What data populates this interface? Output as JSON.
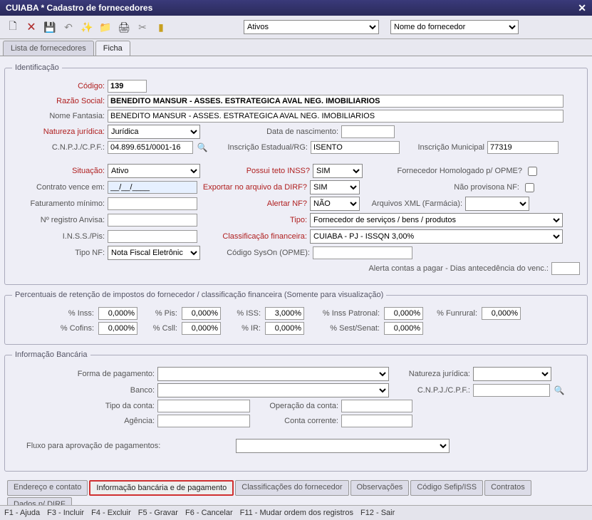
{
  "window": {
    "title": "CUIABA * Cadastro de fornecedores"
  },
  "toolbar": {
    "filter1": "Ativos",
    "filter2": "Nome do fornecedor"
  },
  "tabs": {
    "list": "Lista de fornecedores",
    "ficha": "Ficha"
  },
  "identificacao": {
    "legend": "Identificação",
    "codigo_label": "Código:",
    "codigo": "139",
    "razao_label": "Razão Social:",
    "razao": "BENEDITO MANSUR - ASSES. ESTRATEGICA AVAL NEG. IMOBILIARIOS",
    "fantasia_label": "Nome Fantasia:",
    "fantasia": "BENEDITO MANSUR - ASSES. ESTRATEGICA AVAL NEG. IMOBILIARIOS",
    "natureza_label": "Natureza jurídica:",
    "natureza": "Jurídica",
    "data_nasc_label": "Data de nascimento:",
    "data_nasc": "",
    "cnpj_label": "C.N.P.J./C.P.F.:",
    "cnpj": "04.899.651/0001-16",
    "insc_est_label": "Inscrição Estadual/RG:",
    "insc_est": "ISENTO",
    "insc_mun_label": "Inscrição Municipal",
    "insc_mun": "77319",
    "situacao_label": "Situação:",
    "situacao": "Ativo",
    "teto_inss_label": "Possui teto INSS?",
    "teto_inss": "SIM",
    "homolog_label": "Fornecedor Homologado p/ OPME?",
    "contrato_label": "Contrato vence em:",
    "contrato": "__/__/____",
    "exportar_dirf_label": "Exportar no arquivo da DIRF?",
    "exportar_dirf": "SIM",
    "nao_provisiona_label": "Não provisona NF:",
    "fat_min_label": "Faturamento mínimo:",
    "fat_min": "",
    "alertar_nf_label": "Alertar NF?",
    "alertar_nf": "NÃO",
    "arquivos_xml_label": "Arquivos XML (Farmácia):",
    "arquivos_xml": "",
    "anvisa_label": "Nº registro Anvisa:",
    "anvisa": "",
    "tipo_label": "Tipo:",
    "tipo": "Fornecedor de serviços / bens / produtos",
    "inss_pis_label": "I.N.S.S./Pis:",
    "inss_pis": "",
    "class_fin_label": "Classificação financeira:",
    "class_fin": "CUIABA - PJ - ISSQN 3,00%",
    "tipo_nf_label": "Tipo NF:",
    "tipo_nf": "Nota Fiscal Eletrônic",
    "codigo_syson_label": "Código SysOn (OPME):",
    "codigo_syson": "",
    "alerta_contas_label": "Alerta contas a pagar - Dias antecedência do venc.:",
    "alerta_contas": ""
  },
  "percentuais": {
    "legend": "Percentuais de retenção de impostos do fornecedor / classificação financeira (Somente para visualização)",
    "inss_label": "% Inss:",
    "inss": "0,000%",
    "pis_label": "% Pis:",
    "pis": "0,000%",
    "iss_label": "% ISS:",
    "iss": "3,000%",
    "inss_patronal_label": "% Inss Patronal:",
    "inss_patronal": "0,000%",
    "funrural_label": "% Funrural:",
    "funrural": "0,000%",
    "cofins_label": "% Cofins:",
    "cofins": "0,000%",
    "csll_label": "% Csll:",
    "csll": "0,000%",
    "ir_label": "% IR:",
    "ir": "0,000%",
    "sest_label": "% Sest/Senat:",
    "sest": "0,000%"
  },
  "bancaria": {
    "legend": "Informação Bancária",
    "forma_pag_label": "Forma de pagamento:",
    "forma_pag": "",
    "natureza_label": "Natureza jurídica:",
    "natureza": "",
    "banco_label": "Banco:",
    "banco": "",
    "cnpj_label": "C.N.P.J./C.P.F.:",
    "cnpj": "",
    "tipo_conta_label": "Tipo da conta:",
    "tipo_conta": "",
    "operacao_label": "Operação da conta:",
    "operacao": "",
    "agencia_label": "Agência:",
    "agencia": "",
    "conta_label": "Conta corrente:",
    "conta": "",
    "fluxo_label": "Fluxo para aprovação de pagamentos:",
    "fluxo": ""
  },
  "bottom_tabs": {
    "endereco": "Endereço e contato",
    "info_banc": "Informação bancária e de pagamento",
    "class_forn": "Classificações do fornecedor",
    "obs": "Observações",
    "sefip": "Código Sefip/ISS",
    "contratos": "Contratos",
    "dados_dirf": "Dados p/ DIRF"
  },
  "footer": {
    "f1": "F1 - Ajuda",
    "f3": "F3 - Incluir",
    "f4": "F4 - Excluir",
    "f5": "F5 - Gravar",
    "f6": "F6 - Cancelar",
    "f11": "F11 - Mudar ordem dos registros",
    "f12": "F12 - Sair"
  }
}
